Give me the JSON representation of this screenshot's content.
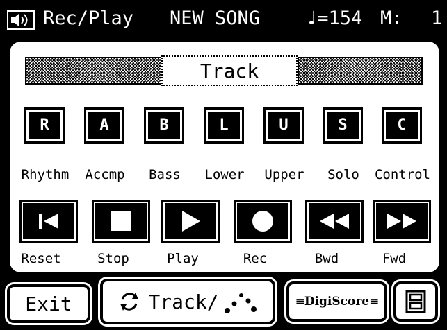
{
  "header": {
    "mode": "Rec/Play",
    "song": "NEW SONG",
    "tempo": "♩=154",
    "measure_label": "M:",
    "measure_value": "1"
  },
  "section_title": "Track",
  "tracks": [
    {
      "key": "R",
      "label": "Rhythm"
    },
    {
      "key": "A",
      "label": "Accmp"
    },
    {
      "key": "B",
      "label": "Bass"
    },
    {
      "key": "L",
      "label": "Lower"
    },
    {
      "key": "U",
      "label": "Upper"
    },
    {
      "key": "S",
      "label": "Solo"
    },
    {
      "key": "C",
      "label": "Control"
    }
  ],
  "transport": [
    {
      "icon": "reset-icon",
      "label": "Reset"
    },
    {
      "icon": "stop-icon",
      "label": "Stop"
    },
    {
      "icon": "play-icon",
      "label": "Play"
    },
    {
      "icon": "record-icon",
      "label": "Rec"
    },
    {
      "icon": "rewind-icon",
      "label": "Bwd"
    },
    {
      "icon": "fast-forward-icon",
      "label": "Fwd"
    }
  ],
  "bottom": {
    "exit": "Exit",
    "track_view": "Track/",
    "digiscore": "DigiScore"
  },
  "icons": {
    "speaker": "speaker-icon",
    "view_toggle": "refresh-icon",
    "notes": "notes-dots-icon",
    "menu": "menu-icon"
  }
}
